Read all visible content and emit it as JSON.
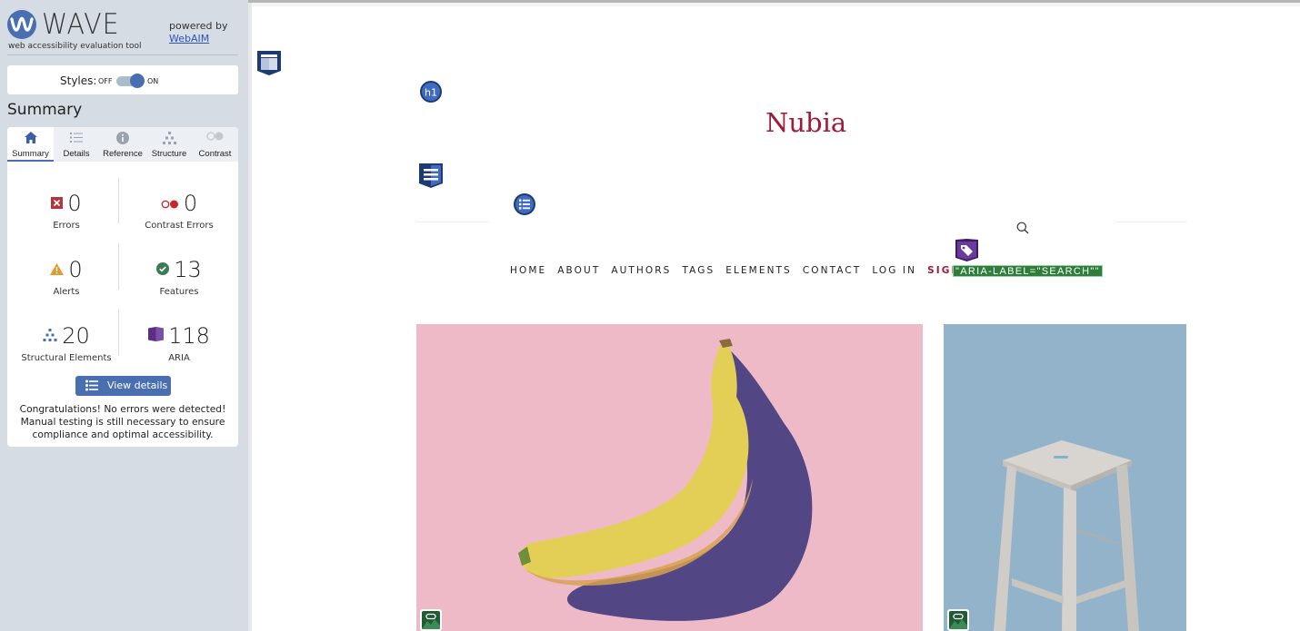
{
  "sidebar": {
    "brand": {
      "name": "WAVE",
      "tagline": "web accessibility evaluation tool",
      "powered_by": "powered by",
      "powered_link": "WebAIM",
      "logo_icon": "wave-logo-icon"
    },
    "styles_toggle": {
      "label": "Styles:",
      "off_label": "OFF",
      "on_label": "ON",
      "state": "on"
    },
    "section_title": "Summary",
    "tabs": [
      {
        "label": "Summary",
        "icon": "home-icon",
        "active": true
      },
      {
        "label": "Details",
        "icon": "list-icon",
        "active": false
      },
      {
        "label": "Reference",
        "icon": "info-icon",
        "active": false
      },
      {
        "label": "Structure",
        "icon": "hierarchy-icon",
        "active": false
      },
      {
        "label": "Contrast",
        "icon": "contrast-icon",
        "active": false
      }
    ],
    "stats": {
      "errors": {
        "value": "0",
        "label": "Errors",
        "icon": "error-x-icon"
      },
      "contrast_errors": {
        "value": "0",
        "label": "Contrast Errors",
        "icon": "contrast-dots-icon"
      },
      "alerts": {
        "value": "0",
        "label": "Alerts",
        "icon": "warning-triangle-icon"
      },
      "features": {
        "value": "13",
        "label": "Features",
        "icon": "check-circle-icon"
      },
      "structural": {
        "value": "20",
        "label": "Structural Elements",
        "icon": "hierarchy-icon"
      },
      "aria": {
        "value": "118",
        "label": "ARIA",
        "icon": "aria-cube-icon"
      }
    },
    "view_details_label": "View details ›",
    "congrats": "Congratulations! No errors were detected! Manual testing is still necessary to ensure compliance and optimal accessibility."
  },
  "page": {
    "site_title": "Nubia",
    "nav_items": [
      {
        "label": "HOME"
      },
      {
        "label": "ABOUT"
      },
      {
        "label": "AUTHORS"
      },
      {
        "label": "TAGS"
      },
      {
        "label": "ELEMENTS"
      },
      {
        "label": "CONTACT"
      },
      {
        "label": "LOG IN"
      },
      {
        "label": "SIGN UP",
        "highlight": true
      }
    ],
    "aria_label_annotation": "\"ARIA-LABEL=\"SEARCH\"\"",
    "wave_icons": [
      "header-region-icon",
      "h1-heading-icon",
      "nav-region-icon",
      "unordered-list-icon",
      "aria-label-icon",
      "linked-image-alt-icon"
    ],
    "h1_badge": "h1",
    "images": [
      {
        "subject": "banana on pink background"
      },
      {
        "subject": "wooden stool on blue background"
      }
    ],
    "colors": {
      "brand_red": "#9e1b3b",
      "wave_blue": "#4a6fb0",
      "aria_purple": "#5b2d86",
      "feature_green": "#2e7d3a"
    }
  }
}
